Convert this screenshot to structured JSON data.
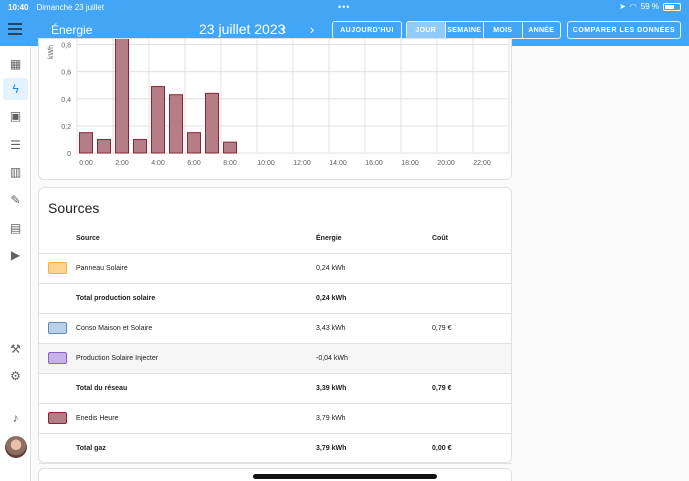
{
  "status": {
    "time": "10:40",
    "date": "Dimanche 23 juillet",
    "battery": "59 %"
  },
  "header": {
    "title": "Énergie",
    "date": "23 juillet 2023",
    "prev": "‹",
    "next": "›",
    "today_button": "AUJOURD'HUI",
    "periods": [
      "JOUR",
      "SEMAINE",
      "MOIS",
      "ANNÉE"
    ],
    "active_period": "JOUR",
    "compare_button": "COMPARER LES DONNÉES"
  },
  "sidebar": {
    "items": [
      "overview-icon",
      "energy-icon",
      "logbook-icon",
      "todo-icon",
      "history-icon",
      "tools-icon",
      "media-icon",
      "media-player-icon",
      "developer-icon",
      "settings-icon",
      "notifications-icon"
    ],
    "active": "energy-icon"
  },
  "chart_data": {
    "type": "bar",
    "ylabel": "kWh",
    "ylim": [
      0,
      0.9
    ],
    "yticks": [
      "0",
      "0,2",
      "0,4",
      "0,6",
      "0,8"
    ],
    "xticks": [
      "0:00",
      "2:00",
      "4:00",
      "6:00",
      "8:00",
      "10:00",
      "12:00",
      "14:00",
      "16:00",
      "18:00",
      "20:00",
      "22:00"
    ],
    "hours": [
      0,
      1,
      2,
      3,
      4,
      5,
      6,
      7,
      8
    ],
    "values": [
      0.15,
      0.1,
      0.95,
      0.1,
      0.49,
      0.43,
      0.15,
      0.44,
      0.08
    ],
    "bar_color": "#b57d86",
    "bar_border": "#8b2336"
  },
  "sources": {
    "title": "Sources",
    "columns": {
      "source": "Source",
      "energy": "Énergie",
      "cost": "Coût"
    },
    "rows": [
      {
        "swatch": "#fdd391",
        "swatch_border": "#f4b042",
        "source": "Panneau Solaire",
        "energy": "0,24 kWh",
        "cost": "",
        "bold": false
      },
      {
        "swatch": "",
        "source": "Total production solaire",
        "energy": "0,24 kWh",
        "cost": "",
        "bold": true
      },
      {
        "swatch": "#b6d1e8",
        "swatch_border": "#5e8cb7",
        "source": "Conso Maison et Solaire",
        "energy": "3,43 kWh",
        "cost": "0,79 €",
        "bold": false
      },
      {
        "swatch": "#c7b2e8",
        "swatch_border": "#8a65c7",
        "source": "Production Solaire Injecter",
        "energy": "-0,04 kWh",
        "cost": "",
        "bold": false,
        "highlight": true
      },
      {
        "swatch": "",
        "source": "Total du réseau",
        "energy": "3,39 kWh",
        "cost": "0,79 €",
        "bold": true
      },
      {
        "swatch": "#b57d86",
        "swatch_border": "#8b2336",
        "source": "Enedis Heure",
        "energy": "3,79 kWh",
        "cost": "",
        "bold": false
      },
      {
        "swatch": "",
        "source": "Total gaz",
        "energy": "3,79 kWh",
        "cost": "0,00 €",
        "bold": true
      }
    ]
  }
}
